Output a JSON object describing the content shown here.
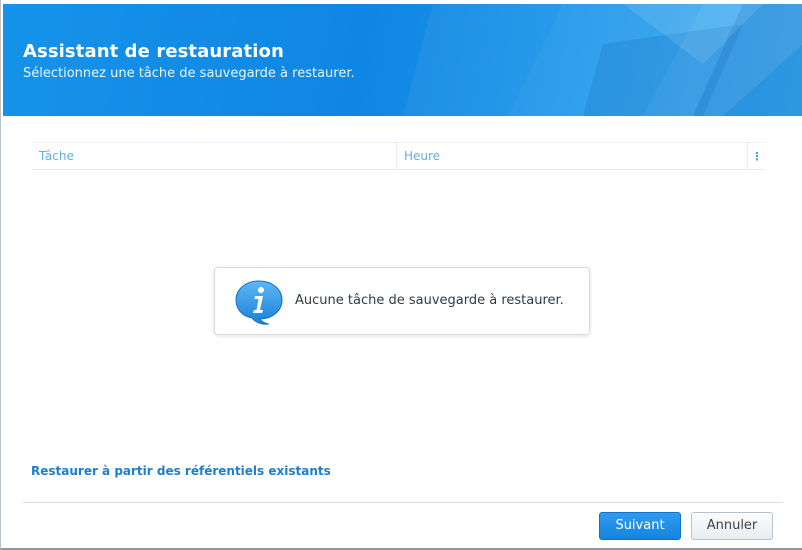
{
  "wizard": {
    "title": "Assistant de restauration",
    "subtitle": "Sélectionnez une tâche de sauvegarde à restaurer."
  },
  "grid": {
    "columns": [
      "Tâche",
      "Heure"
    ],
    "menu_glyph": "⋮",
    "rows": []
  },
  "empty_state": {
    "icon": "info-speech-bubble-icon",
    "message": "Aucune tâche de sauvegarde à restaurer."
  },
  "links": {
    "restore_from_existing": "Restaurer à partir des référentiels existants"
  },
  "footer": {
    "next_label": "Suivant",
    "cancel_label": "Annuler"
  },
  "colors": {
    "header_blue": "#0f86e3",
    "accent": "#1a7fd1",
    "column_header_text": "#5fb0e6"
  }
}
